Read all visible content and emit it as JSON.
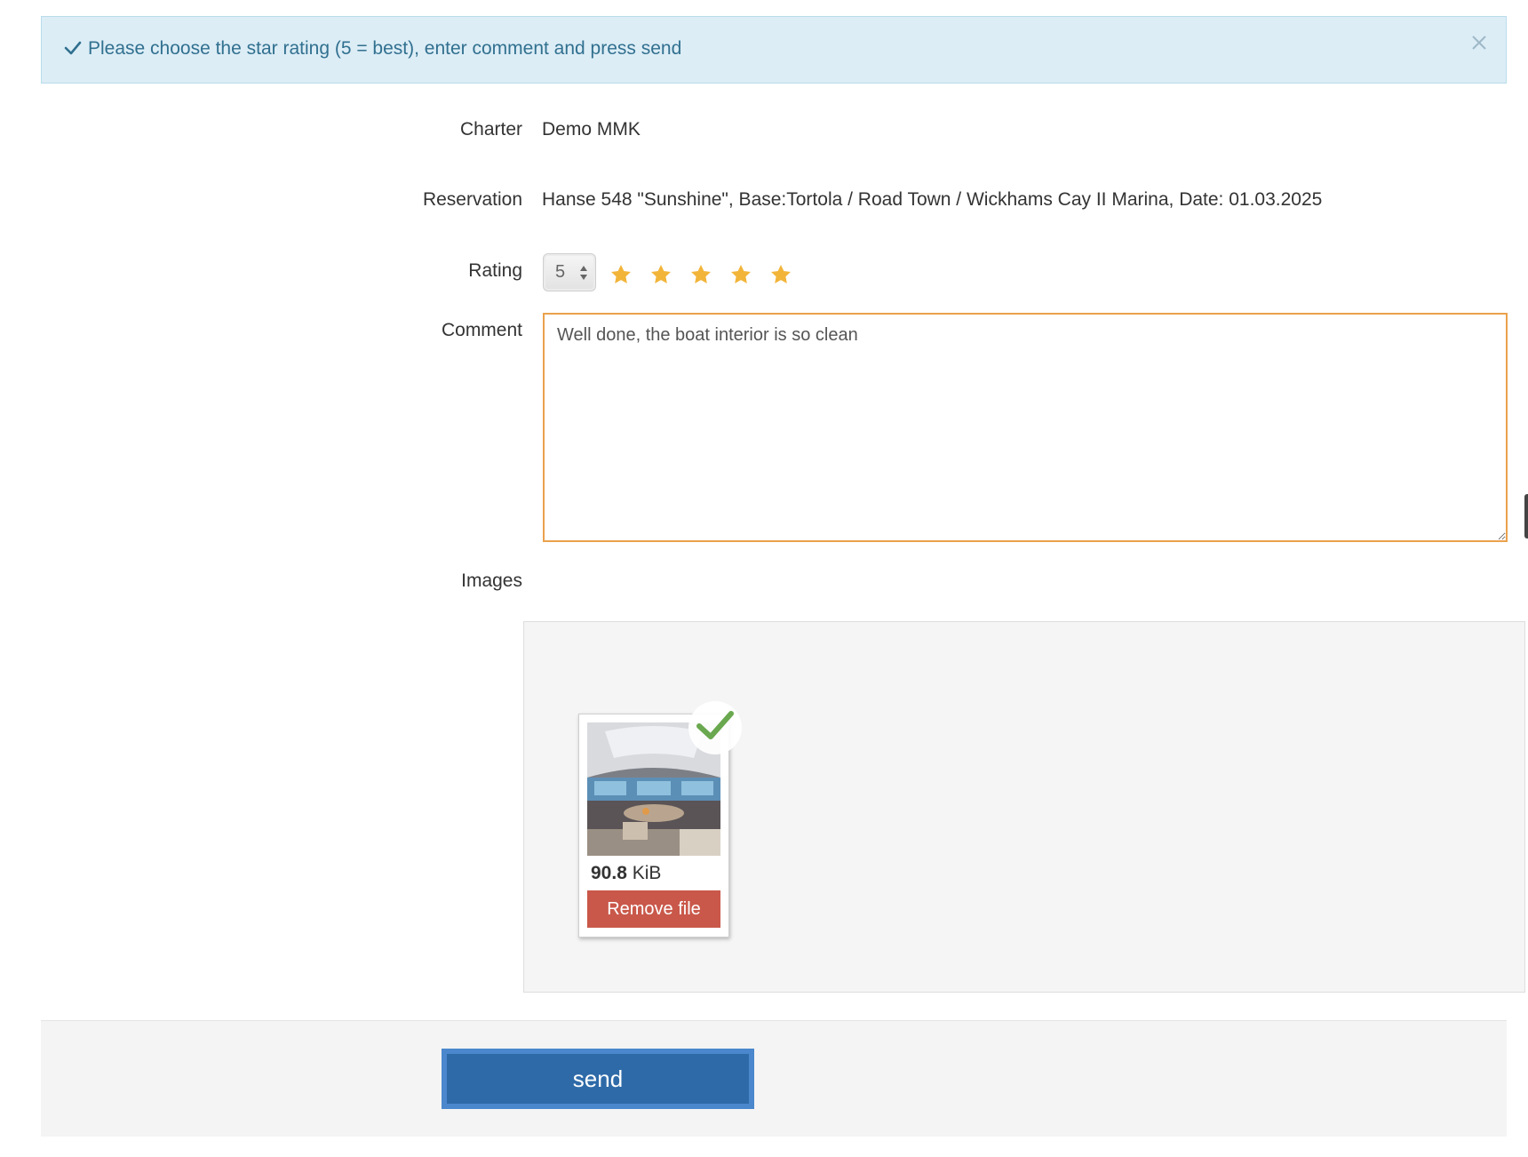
{
  "alert": {
    "message": "Please choose the star rating (5 = best), enter comment and press send",
    "icon": "check-icon",
    "close_icon": "close-icon",
    "color": "#31708f"
  },
  "form": {
    "charter": {
      "label": "Charter",
      "value": "Demo MMK"
    },
    "reservation": {
      "label": "Reservation",
      "value": "Hanse 548 \"Sunshine\", Base:Tortola / Road Town / Wickhams Cay II Marina, Date: 01.03.2025"
    },
    "rating": {
      "label": "Rating",
      "selected": "5",
      "stars_filled": 5,
      "stars_total": 5,
      "star_color": "#f2b53a"
    },
    "comment": {
      "label": "Comment",
      "value": "Well done, the boat interior is so clean"
    },
    "images": {
      "label": "Images",
      "files": [
        {
          "size_value": "90.8",
          "size_unit": "KiB",
          "remove_label": "Remove file",
          "status": "success"
        }
      ]
    }
  },
  "footer": {
    "send_label": "send",
    "accent": "#2e6aa8"
  }
}
